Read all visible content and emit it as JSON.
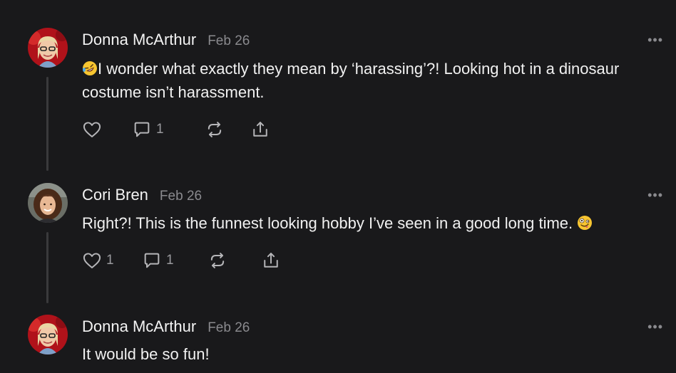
{
  "comments": [
    {
      "author": "Donna McArthur",
      "date": "Feb 26",
      "text": "I wonder what exactly they mean by ‘harassing’?! Looking hot in a dinosaur costume isn’t harassment.",
      "leading_emoji": "rolling-on-floor-laughing",
      "likes": "",
      "replies": "1"
    },
    {
      "author": "Cori Bren",
      "date": "Feb 26",
      "text": "Right?! This is the funnest looking hobby I’ve seen in a good long time.",
      "trailing_emoji": "zany-face",
      "likes": "1",
      "replies": "1"
    },
    {
      "author": "Donna McArthur",
      "date": "Feb 26",
      "text": "It would be so fun!"
    }
  ],
  "more_label": "•••",
  "colors": {
    "background": "#19191b",
    "text": "#f1f1f1",
    "muted": "#8a8a8e",
    "thread_line": "#3a3a3c"
  }
}
